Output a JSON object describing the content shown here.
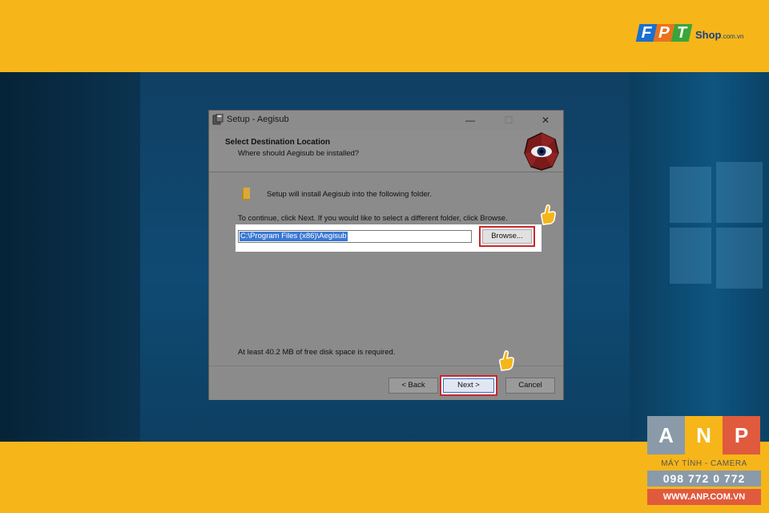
{
  "branding": {
    "fpt_letters": [
      "F",
      "P",
      "T"
    ],
    "fpt_shop": "Shop",
    "fpt_domain": ".com.vn",
    "anp_letters": [
      "A",
      "N",
      "P"
    ],
    "anp_tagline": "MÁY TÍNH - CAMERA",
    "anp_phone": "098 772 0 772",
    "anp_website": "WWW.ANP.COM.VN"
  },
  "dialog": {
    "title": "Setup - Aegisub",
    "window_buttons": {
      "minimize": "—",
      "maximize": "☐",
      "close": "✕"
    },
    "header_title": "Select Destination Location",
    "header_subtitle": "Where should Aegisub be installed?",
    "install_message": "Setup will install Aegisub into the following folder.",
    "continue_message": "To continue, click Next. If you would like to select a different folder, click Browse.",
    "path_value": "C:\\Program Files (x86)\\Aegisub",
    "browse_label": "Browse...",
    "disk_space_message": "At least 40.2 MB of free disk space is required.",
    "back_label": "< Back",
    "next_label": "Next >",
    "cancel_label": "Cancel"
  },
  "colors": {
    "band": "#f6b619",
    "highlight_outline": "#c8282c",
    "selection": "#3a78d4"
  },
  "icons": [
    "setup-icon",
    "aegisub-eye-icon",
    "folder-icon",
    "pointing-hand-icon"
  ]
}
